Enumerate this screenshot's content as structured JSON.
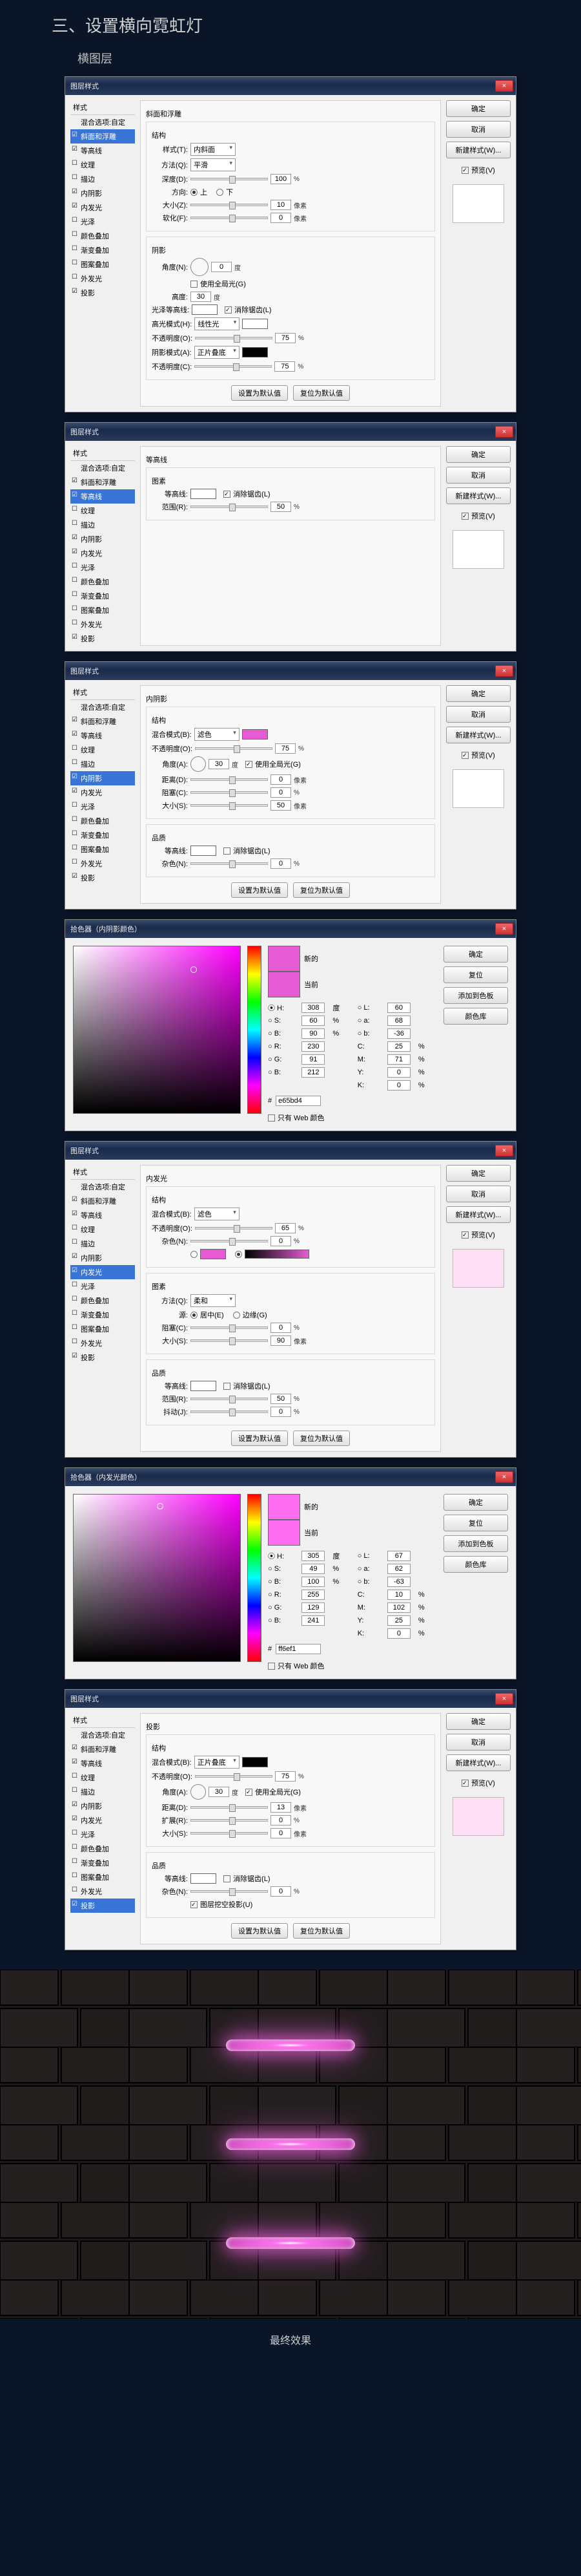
{
  "page_title": "三、设置横向霓虹灯",
  "section_label": "横图层",
  "styles_list": [
    "混合选项:自定",
    "斜面和浮雕",
    "等高线",
    "纹理",
    "描边",
    "内阴影",
    "内发光",
    "光泽",
    "颜色叠加",
    "渐变叠加",
    "图案叠加",
    "外发光",
    "投影"
  ],
  "right_buttons": {
    "ok": "确定",
    "cancel": "取消",
    "new_style": "新建样式(W)...",
    "preview": "预览(V)"
  },
  "footer_buttons": {
    "default": "设置为默认值",
    "reset": "复位为默认值"
  },
  "dlg1": {
    "title": "图层样式",
    "panel": "斜面和浮雕",
    "group1": "结构",
    "style_l": "样式(T):",
    "style_v": "内斜面",
    "tech_l": "方法(Q):",
    "tech_v": "平滑",
    "depth_l": "深度(D):",
    "depth_v": "100",
    "depth_u": "%",
    "dir_l": "方向:",
    "up": "上",
    "down": "下",
    "size_l": "大小(Z):",
    "size_v": "10",
    "px": "像素",
    "soft_l": "软化(F):",
    "soft_v": "0",
    "group2": "阴影",
    "angle_l": "角度(N):",
    "angle_v": "0",
    "deg": "度",
    "global_l": "使用全局光(G)",
    "alt_l": "高度:",
    "alt_v": "30",
    "gloss_l": "光泽等高线:",
    "anti_l": "消除锯齿(L)",
    "hl_mode_l": "高光模式(H):",
    "hl_mode_v": "线性光",
    "hl_op_l": "不透明度(O):",
    "hl_op_v": "75",
    "sh_mode_l": "阴影模式(A):",
    "sh_mode_v": "正片叠底",
    "sh_op_l": "不透明度(C):",
    "sh_op_v": "75"
  },
  "dlg2": {
    "title": "图层样式",
    "panel": "等高线",
    "group": "图素",
    "contour_l": "等高线:",
    "anti_l": "消除锯齿(L)",
    "range_l": "范围(R):",
    "range_v": "50",
    "pct": "%"
  },
  "dlg3": {
    "title": "图层样式",
    "panel": "内阴影",
    "group1": "结构",
    "blend_l": "混合模式(B):",
    "blend_v": "滤色",
    "op_l": "不透明度(O):",
    "op_v": "75",
    "pct": "%",
    "angle_l": "角度(A):",
    "angle_v": "30",
    "deg": "度",
    "global_l": "使用全局光(G)",
    "dist_l": "距离(D):",
    "dist_v": "0",
    "px": "像素",
    "choke_l": "阻塞(C):",
    "choke_v": "0",
    "size_l": "大小(S):",
    "size_v": "50",
    "group2": "品质",
    "contour_l": "等高线:",
    "anti_l": "消除锯齿(L)",
    "noise_l": "杂色(N):",
    "noise_v": "0"
  },
  "picker1": {
    "title": "拾色器（内阴影颜色）",
    "new_l": "新的",
    "cur_l": "当前",
    "web_l": "只有 Web 颜色",
    "H": "308",
    "S": "60",
    "Bv": "90",
    "R": "230",
    "G": "91",
    "B": "212",
    "L": "60",
    "a": "68",
    "b": "-36",
    "C": "25",
    "M": "71",
    "Y": "0",
    "K": "0",
    "hex": "e65bd4",
    "btns": {
      "ok": "确定",
      "cancel": "复位",
      "add": "添加到色板",
      "lib": "颜色库"
    }
  },
  "dlg4": {
    "title": "图层样式",
    "panel": "内发光",
    "group1": "结构",
    "blend_l": "混合模式(B):",
    "blend_v": "滤色",
    "op_l": "不透明度(O):",
    "op_v": "65",
    "pct": "%",
    "noise_l": "杂色(N):",
    "noise_v": "0",
    "group2": "图素",
    "tech_l": "方法(Q):",
    "tech_v": "柔和",
    "src_l": "源:",
    "center": "居中(E)",
    "edge": "边缘(G)",
    "choke_l": "阻塞(C):",
    "choke_v": "0",
    "size_l": "大小(S):",
    "size_v": "90",
    "px": "像素",
    "group3": "品质",
    "contour_l": "等高线:",
    "anti_l": "消除锯齿(L)",
    "range_l": "范围(R):",
    "range_v": "50",
    "jitter_l": "抖动(J):",
    "jitter_v": "0"
  },
  "picker2": {
    "title": "拾色器（内发光颜色）",
    "new_l": "新的",
    "cur_l": "当前",
    "web_l": "只有 Web 颜色",
    "H": "305",
    "S": "49",
    "Bv": "100",
    "R": "255",
    "G": "129",
    "B": "241",
    "L": "67",
    "a": "62",
    "b": "-63",
    "C": "10",
    "M": "102",
    "Y": "25",
    "K": "0",
    "hex": "ff6ef1",
    "btns": {
      "ok": "确定",
      "cancel": "复位",
      "add": "添加到色板",
      "lib": "颜色库"
    }
  },
  "dlg5": {
    "title": "图层样式",
    "panel": "投影",
    "group1": "结构",
    "blend_l": "混合模式(B):",
    "blend_v": "正片叠底",
    "op_l": "不透明度(O):",
    "op_v": "75",
    "pct": "%",
    "angle_l": "角度(A):",
    "angle_v": "30",
    "deg": "度",
    "global_l": "使用全局光(G)",
    "dist_l": "距离(D):",
    "dist_v": "13",
    "px": "像素",
    "spread_l": "扩展(R):",
    "spread_v": "0",
    "size_l": "大小(S):",
    "size_v": "0",
    "group2": "品质",
    "contour_l": "等高线:",
    "anti_l": "消除锯齿(L)",
    "noise_l": "杂色(N):",
    "noise_v": "0",
    "knockout_l": "图层挖空投影(U)"
  },
  "final_label": "最终效果"
}
